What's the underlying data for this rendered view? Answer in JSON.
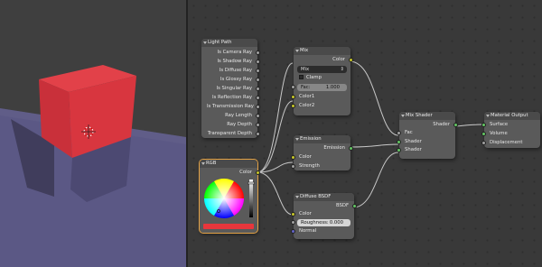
{
  "light_path": {
    "title": "Light Path",
    "outputs": [
      "Is Camera Ray",
      "Is Shadow Ray",
      "Is Diffuse Ray",
      "Is Glossy Ray",
      "Is Singular Ray",
      "Is Reflection Ray",
      "Is Transmission Ray",
      "Ray Length",
      "Ray Depth",
      "Transparent Depth"
    ]
  },
  "mix": {
    "title": "Mix",
    "output": "Color",
    "blend_mode": "Mix",
    "clamp": "Clamp",
    "fac_label": "Fac:",
    "fac_value": "1.000",
    "inputs": [
      "Color1",
      "Color2"
    ]
  },
  "emission": {
    "title": "Emission",
    "output": "Emission",
    "inputs": [
      "Color",
      "Strength"
    ]
  },
  "rgb": {
    "title": "RGB",
    "output": "Color",
    "color": "#e8363c"
  },
  "diffuse": {
    "title": "Diffuse BSDF",
    "output": "BSDF",
    "color_label": "Color",
    "roughness_label": "Roughness:",
    "roughness_value": "0.000",
    "normal_label": "Normal"
  },
  "mix_shader": {
    "title": "Mix Shader",
    "output": "Shader",
    "inputs": [
      "Fac",
      "Shader",
      "Shader"
    ]
  },
  "material_output": {
    "title": "Material Output",
    "inputs": [
      "Surface",
      "Volume",
      "Displacement"
    ]
  },
  "colors": {
    "cube": "#d93a42",
    "floor": "#5b5885",
    "link": "#c8c8c8",
    "selected": "#e3a245"
  }
}
